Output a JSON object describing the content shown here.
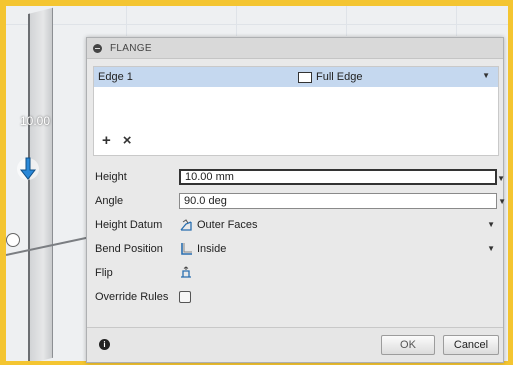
{
  "viewport": {
    "dimension_label": "10.00"
  },
  "dialog": {
    "title": "FLANGE",
    "edges": [
      {
        "name": "Edge 1",
        "type": "Full Edge"
      }
    ],
    "edge_tools": {
      "add": "+",
      "remove": "×"
    },
    "properties": {
      "height": {
        "label": "Height",
        "value": "10.00 mm"
      },
      "angle": {
        "label": "Angle",
        "value": "90.0 deg"
      },
      "height_datum": {
        "label": "Height Datum",
        "value": "Outer Faces"
      },
      "bend_position": {
        "label": "Bend Position",
        "value": "Inside"
      },
      "flip": {
        "label": "Flip"
      },
      "override_rules": {
        "label": "Override Rules",
        "checked": false
      }
    },
    "footer": {
      "info": "i",
      "ok_label": "OK",
      "cancel_label": "Cancel"
    }
  },
  "colors": {
    "frame": "#f4c531",
    "selection": "#c5d8ef",
    "accent_arrow": "#2a88d8"
  }
}
